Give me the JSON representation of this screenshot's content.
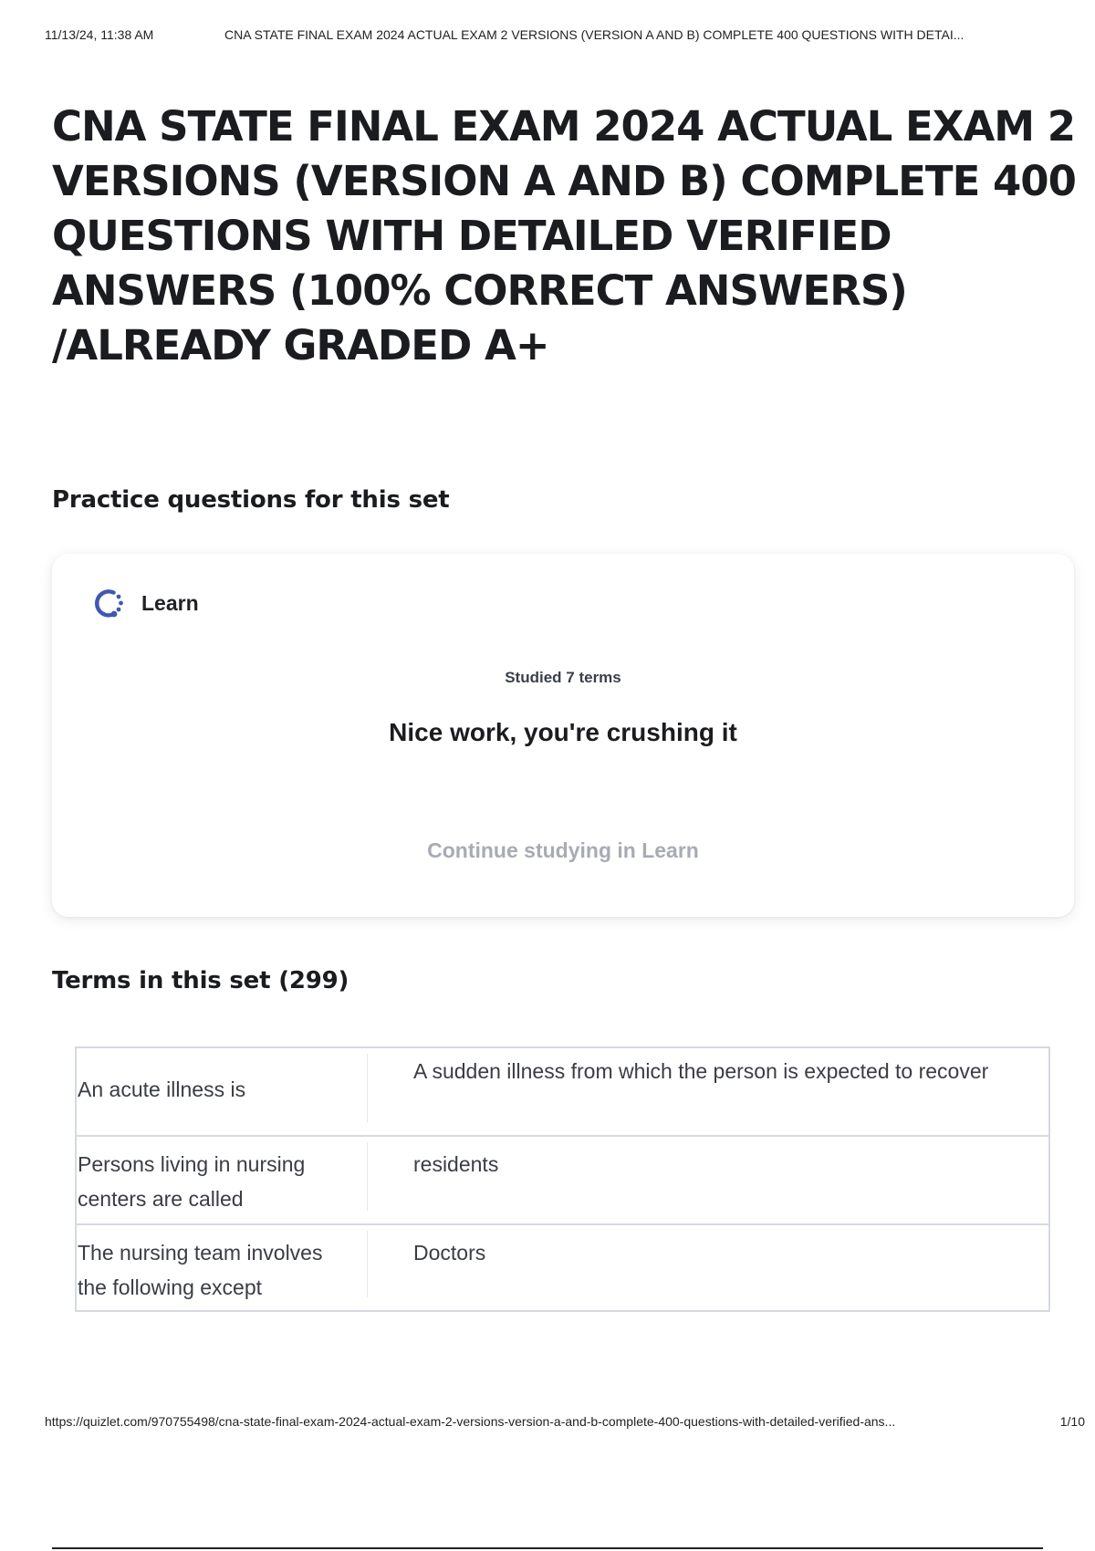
{
  "print_header": {
    "date": "11/13/24, 11:38 AM",
    "title": "CNA STATE FINAL EXAM 2024 ACTUAL EXAM 2 VERSIONS (VERSION A AND B) COMPLETE 400 QUESTIONS WITH DETAI..."
  },
  "set": {
    "title": "CNA STATE FINAL EXAM 2024 ACTUAL EXAM 2 VERSIONS (VERSION A AND B) COMPLETE 400 QUESTIONS WITH DETAILED VERIFIED ANSWERS (100% CORRECT ANSWERS)  /ALREADY GRADED A+"
  },
  "practice": {
    "heading": "Practice questions for this set",
    "card": {
      "mode_label": "Learn",
      "icon": "learn-progress-icon",
      "studied": "Studied 7 terms",
      "message": "Nice work, you're crushing it",
      "continue_label": "Continue studying in Learn"
    }
  },
  "terms": {
    "heading": "Terms in this set (299)",
    "rows": [
      {
        "term": "An acute illness is",
        "definition": "A sudden illness from which the person is expected to recover"
      },
      {
        "term": "Persons living in nursing centers are called",
        "definition": "residents"
      },
      {
        "term": "The nursing team involves the following except",
        "definition": "Doctors"
      }
    ]
  },
  "print_footer": {
    "url": "https://quizlet.com/970755498/cna-state-final-exam-2024-actual-exam-2-versions-version-a-and-b-complete-400-questions-with-detailed-verified-ans...",
    "page": "1/10"
  },
  "colors": {
    "learn_icon": "#4257b2",
    "muted_link": "#a8abb4",
    "table_border": "#d6d9e0"
  }
}
